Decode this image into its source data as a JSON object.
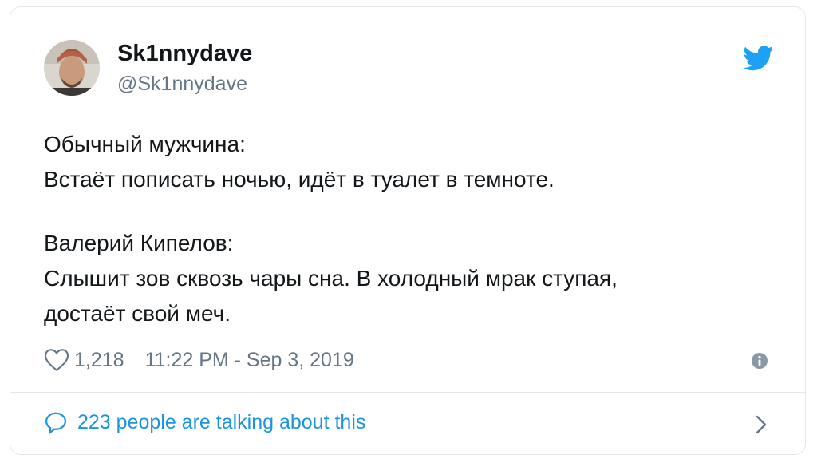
{
  "tweet": {
    "author_name": "Sk1nnydave",
    "author_handle": "@Sk1nnydave",
    "lines": [
      "Обычный мужчина:",
      "Встаёт пописать ночью, идёт в туалет в темноте.",
      "",
      "Валерий Кипелов:",
      "Слышит зов сквозь чары сна. В холодный мрак ступая,",
      "достаёт свой меч."
    ],
    "likes": "1,218",
    "timestamp": "11:22 PM - Sep 3, 2019",
    "talking_label": "223 people are talking about this"
  },
  "icons": {
    "logo": "twitter-bird-icon",
    "like": "heart-icon",
    "info": "info-icon",
    "reply": "speech-bubble-icon",
    "more": "chevron-right-icon"
  },
  "colors": {
    "brand": "#1da1f2",
    "link": "#1b95e0",
    "secondary_text": "#657786",
    "border": "#e1e8ed"
  }
}
